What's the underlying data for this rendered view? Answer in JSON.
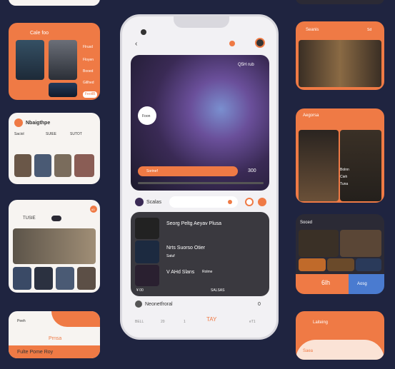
{
  "colors": {
    "accent": "#ef7a45",
    "background": "#1f2440",
    "dark": "#2b2a35"
  },
  "left_cards": {
    "card1": {
      "title": "Cale foo",
      "items": [
        "Flrusd",
        "Floyen",
        "Booed",
        "Gillhed"
      ],
      "button": "FeotlB"
    },
    "card2": {
      "title": "Nbaigthpe",
      "stats": [
        "Saciol",
        "SUIEE",
        "SUTOT"
      ]
    },
    "card3": {
      "title": "TUSIE",
      "badge": "d3"
    },
    "card4": {
      "title": "Peeh",
      "subtitle": "Prnsa",
      "footer": "Fulte Pome Roy"
    }
  },
  "phone": {
    "back_icon": "back-icon",
    "hero": {
      "title": "Q5H rub",
      "label": "Foon",
      "progress_label": "Sorinef",
      "time": "300"
    },
    "section": {
      "title": "Scalas"
    },
    "list": [
      {
        "title": "Seorg Peltg Aeyav Plusa",
        "sub": ""
      },
      {
        "title": "Nrts Suorso Otier",
        "sub": "Satuf"
      },
      {
        "title": "V AHd Slans",
        "sub": "Rolme"
      }
    ],
    "list_footer": {
      "left": "¥ 00",
      "right": "SALSAS"
    },
    "comment": {
      "author": "Neonetfroral",
      "count": "0"
    },
    "nav": [
      "BELL",
      "20",
      "1",
      "TAY",
      "eT1"
    ]
  },
  "right_cards": {
    "card1": {
      "title": "Seanis",
      "button": "Sd"
    },
    "card2": {
      "title": "Aegorsa",
      "tags": [
        "Bolnn",
        "Cieh",
        "Tuna"
      ]
    },
    "card3": {
      "title": "Soced",
      "footer_left": "6lh",
      "footer_right": "Aosg"
    },
    "card4": {
      "title": "Laiteing",
      "sub": "Saea"
    }
  }
}
